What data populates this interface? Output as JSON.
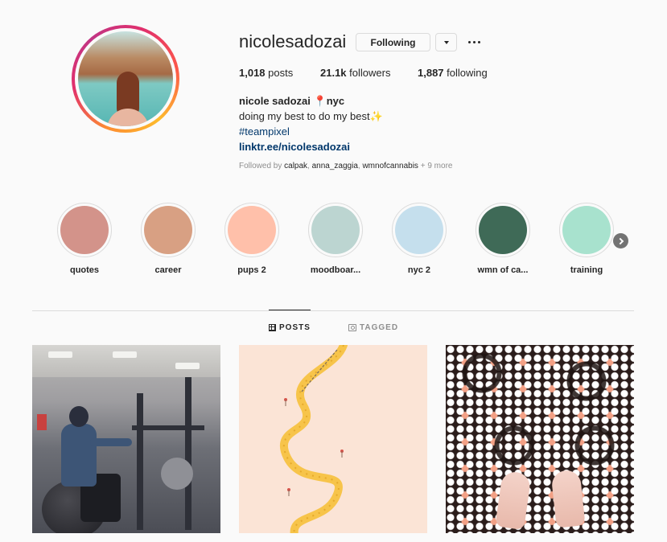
{
  "profile": {
    "username": "nicolesadozai",
    "following_button": "Following",
    "stats": {
      "posts_count": "1,018",
      "posts_label": "posts",
      "followers_count": "21.1k",
      "followers_label": "followers",
      "following_count": "1,887",
      "following_label": "following"
    },
    "bio": {
      "name": "nicole sadozai",
      "pin": "📍",
      "location": "nyc",
      "line1": "doing my best to do my best",
      "sparkle": "✨",
      "hashtag": "#teampixel",
      "link": "linktr.ee/nicolesadozai"
    },
    "followed_by": {
      "prefix": "Followed by",
      "accounts": [
        "calpak",
        "anna_zaggia",
        "wmnofcannabis"
      ],
      "more": "+ 9 more"
    }
  },
  "highlights": [
    {
      "label": "quotes",
      "color": "#d3938a"
    },
    {
      "label": "career",
      "color": "#d8a083"
    },
    {
      "label": "pups 2",
      "color": "#ffc0aa"
    },
    {
      "label": "moodboar...",
      "color": "#bcd5d1"
    },
    {
      "label": "nyc 2",
      "color": "#c5dfed"
    },
    {
      "label": "wmn of ca...",
      "color": "#3f6a57"
    },
    {
      "label": "training",
      "color": "#a8e2ce"
    }
  ],
  "tabs": {
    "posts": "POSTS",
    "tagged": "TAGGED"
  },
  "colors": {
    "accent_link": "#00376b",
    "text": "#262626",
    "muted": "#8e8e8e"
  }
}
